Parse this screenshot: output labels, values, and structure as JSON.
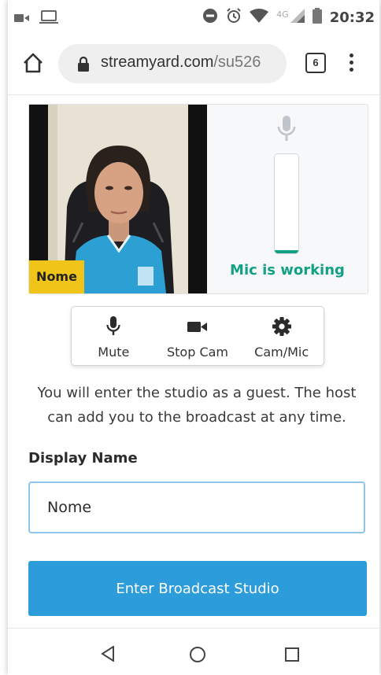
{
  "status_bar": {
    "time": "20:32",
    "network": "4G",
    "icons": [
      "video-notification-icon",
      "laptop-icon",
      "do-not-disturb-icon",
      "alarm-icon",
      "wifi-icon",
      "signal-icon",
      "battery-icon"
    ]
  },
  "browser": {
    "url_domain": "streamyard.com",
    "url_path": "/su526",
    "tab_count": "6"
  },
  "preview": {
    "name_tag": "Nome",
    "mic_status": "Mic is working",
    "mic_level": 0.03,
    "accent_color": "#14a085",
    "tag_color": "#f0c419"
  },
  "controls": [
    {
      "label": "Mute",
      "icon": "microphone-icon"
    },
    {
      "label": "Stop Cam",
      "icon": "camera-icon"
    },
    {
      "label": "Cam/Mic",
      "icon": "gear-icon"
    }
  ],
  "info_text": "You will enter the studio as a guest. The host can add you to the broadcast at any time.",
  "form": {
    "display_name_label": "Display Name",
    "display_name_value": "Nome"
  },
  "enter_button": {
    "label": "Enter Broadcast Studio",
    "color": "#2d9cdb"
  }
}
